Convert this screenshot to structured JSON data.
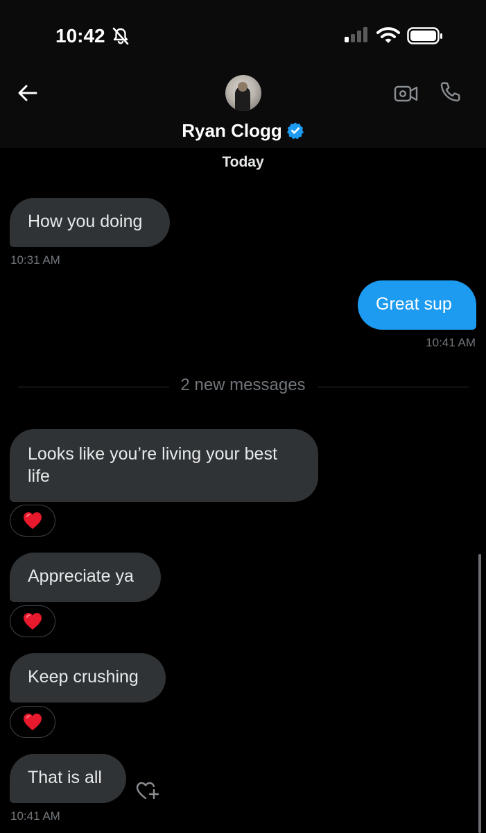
{
  "status_bar": {
    "time": "10:42"
  },
  "header": {
    "contact_name": "Ryan Clogg",
    "verified": true,
    "accent_color": "#1d9bf0"
  },
  "date_label": "Today",
  "messages": [
    {
      "direction": "incoming",
      "text": "How you doing",
      "time": "10:31 AM"
    },
    {
      "direction": "outgoing",
      "text": "Great sup",
      "time": "10:41 AM"
    }
  ],
  "new_messages_divider": "2 new messages",
  "new_messages": [
    {
      "direction": "incoming",
      "text": "Looks like you’re living your best life",
      "reaction": "heart-emoji"
    },
    {
      "direction": "incoming",
      "text": "Appreciate ya",
      "reaction": "heart-emoji"
    },
    {
      "direction": "incoming",
      "text": "Keep crushing",
      "reaction": "heart-emoji"
    },
    {
      "direction": "incoming",
      "text": "That is all",
      "time": "10:41 AM",
      "reaction_button": "heart-plus-icon"
    }
  ]
}
